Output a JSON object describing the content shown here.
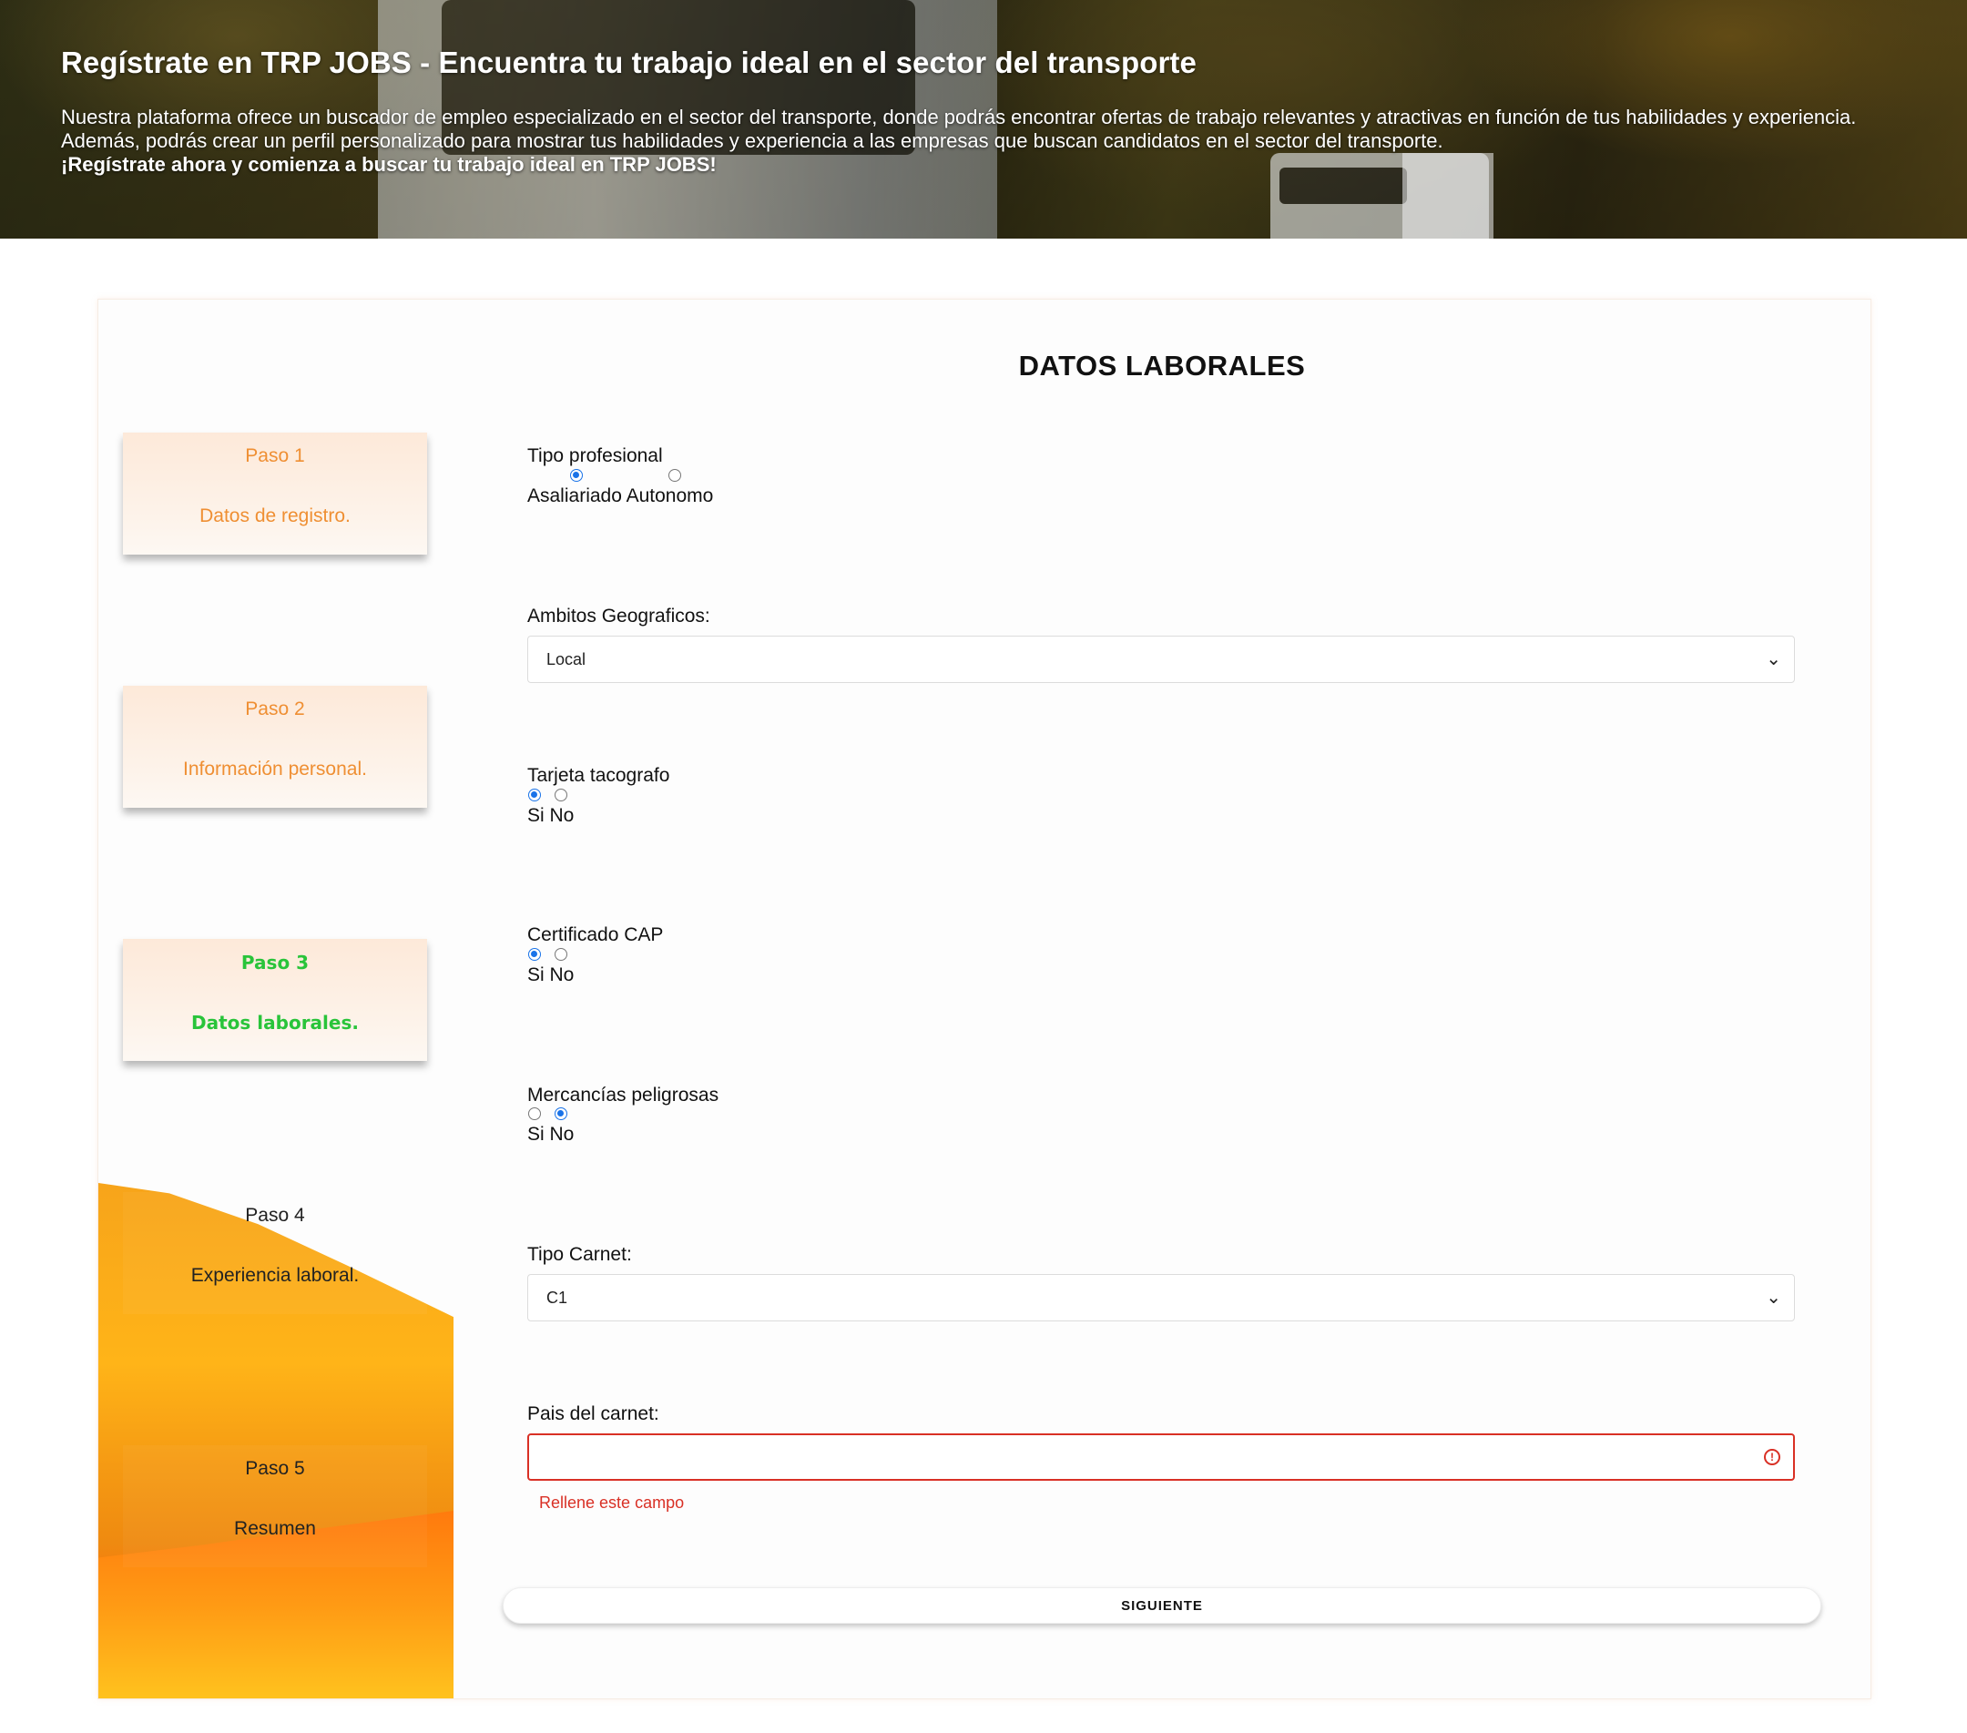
{
  "header": {
    "title": "Regístrate en TRP JOBS - Encuentra tu trabajo ideal en el sector del transporte",
    "description": "Nuestra plataforma ofrece un buscador de empleo especializado en el sector del transporte, donde podrás encontrar ofertas de trabajo relevantes y atractivas en función de tus habilidades y experiencia. Además, podrás crear un perfil personalizado para mostrar tus habilidades y experiencia a las empresas que buscan candidatos en el sector del transporte.",
    "cta": "¡Regístrate ahora y comienza a buscar tu trabajo ideal en TRP JOBS!"
  },
  "steps": [
    {
      "title": "Paso 1",
      "label": "Datos de registro."
    },
    {
      "title": "Paso 2",
      "label": "Información personal."
    },
    {
      "title": "Paso 3",
      "label": "Datos laborales."
    },
    {
      "title": "Paso 4",
      "label": "Experiencia laboral."
    },
    {
      "title": "Paso 5",
      "label": "Resumen"
    }
  ],
  "active_step": 3,
  "form": {
    "title": "DATOS LABORALES",
    "tipo_profesional": {
      "label": "Tipo profesional",
      "options_text": "Asaliariado Autonomo",
      "selected": "Asaliariado"
    },
    "ambitos": {
      "label": "Ambitos Geograficos:",
      "value": "Local"
    },
    "tacografo": {
      "label": "Tarjeta tacografo",
      "options_text": "Si No",
      "selected": "Si"
    },
    "cap": {
      "label": "Certificado CAP",
      "options_text": "Si No",
      "selected": "Si"
    },
    "mercancias": {
      "label": "Mercancías peligrosas",
      "options_text": "Si No",
      "selected": "No"
    },
    "tipo_carnet": {
      "label": "Tipo Carnet:",
      "value": "C1"
    },
    "pais_carnet": {
      "label": "Pais del carnet:",
      "value": "",
      "error": "Rellene este campo"
    },
    "submit_label": "SIGUIENTE"
  },
  "colors": {
    "accent_orange": "#ef8f33",
    "active_green": "#29c43a",
    "error_red": "#d93025",
    "radio_blue": "#1a73e8"
  }
}
